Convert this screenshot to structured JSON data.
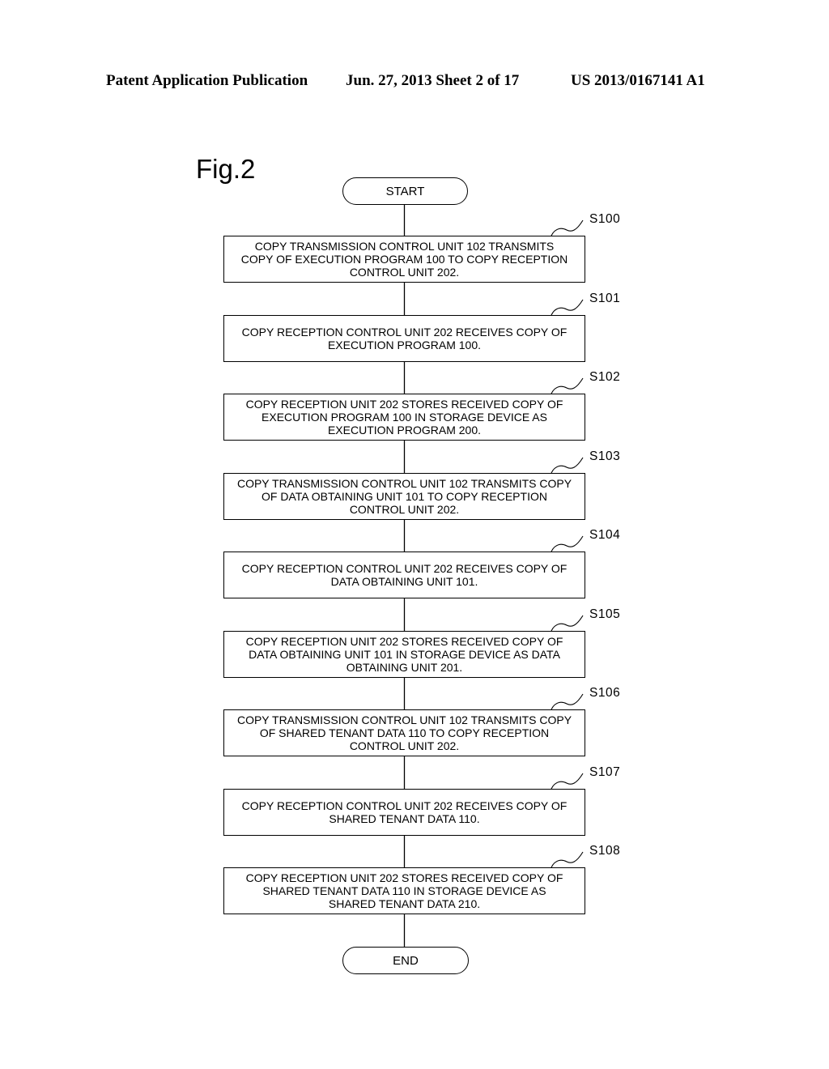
{
  "header": {
    "left": "Patent Application Publication",
    "middle": "Jun. 27, 2013  Sheet 2 of 17",
    "right": "US 2013/0167141 A1"
  },
  "figure": {
    "label": "Fig.2",
    "start_label": "START",
    "end_label": "END",
    "steps": [
      {
        "id": "S100",
        "lines": [
          "COPY TRANSMISSION CONTROL UNIT 102 TRANSMITS",
          "COPY OF EXECUTION PROGRAM 100 TO COPY RECEPTION",
          "CONTROL UNIT 202."
        ]
      },
      {
        "id": "S101",
        "lines": [
          "COPY RECEPTION CONTROL UNIT 202 RECEIVES COPY OF",
          "EXECUTION PROGRAM 100."
        ]
      },
      {
        "id": "S102",
        "lines": [
          "COPY RECEPTION UNIT 202 STORES RECEIVED COPY OF",
          "EXECUTION PROGRAM 100 IN STORAGE DEVICE AS",
          "EXECUTION PROGRAM 200."
        ]
      },
      {
        "id": "S103",
        "lines": [
          "COPY TRANSMISSION CONTROL UNIT 102 TRANSMITS COPY",
          "OF DATA OBTAINING UNIT 101 TO COPY RECEPTION",
          "CONTROL UNIT 202."
        ]
      },
      {
        "id": "S104",
        "lines": [
          "COPY RECEPTION CONTROL UNIT 202 RECEIVES COPY OF",
          "DATA OBTAINING UNIT 101."
        ]
      },
      {
        "id": "S105",
        "lines": [
          "COPY RECEPTION UNIT 202 STORES RECEIVED COPY OF",
          "DATA OBTAINING UNIT 101 IN STORAGE DEVICE AS DATA",
          "OBTAINING UNIT 201."
        ]
      },
      {
        "id": "S106",
        "lines": [
          "COPY TRANSMISSION CONTROL UNIT 102 TRANSMITS COPY",
          "OF SHARED TENANT DATA 110 TO COPY RECEPTION",
          "CONTROL UNIT 202."
        ]
      },
      {
        "id": "S107",
        "lines": [
          "COPY RECEPTION CONTROL UNIT 202 RECEIVES COPY OF",
          "SHARED TENANT DATA 110."
        ]
      },
      {
        "id": "S108",
        "lines": [
          "COPY RECEPTION UNIT 202 STORES RECEIVED COPY OF",
          "SHARED TENANT DATA 110 IN STORAGE DEVICE AS",
          "SHARED TENANT DATA 210."
        ]
      }
    ]
  }
}
